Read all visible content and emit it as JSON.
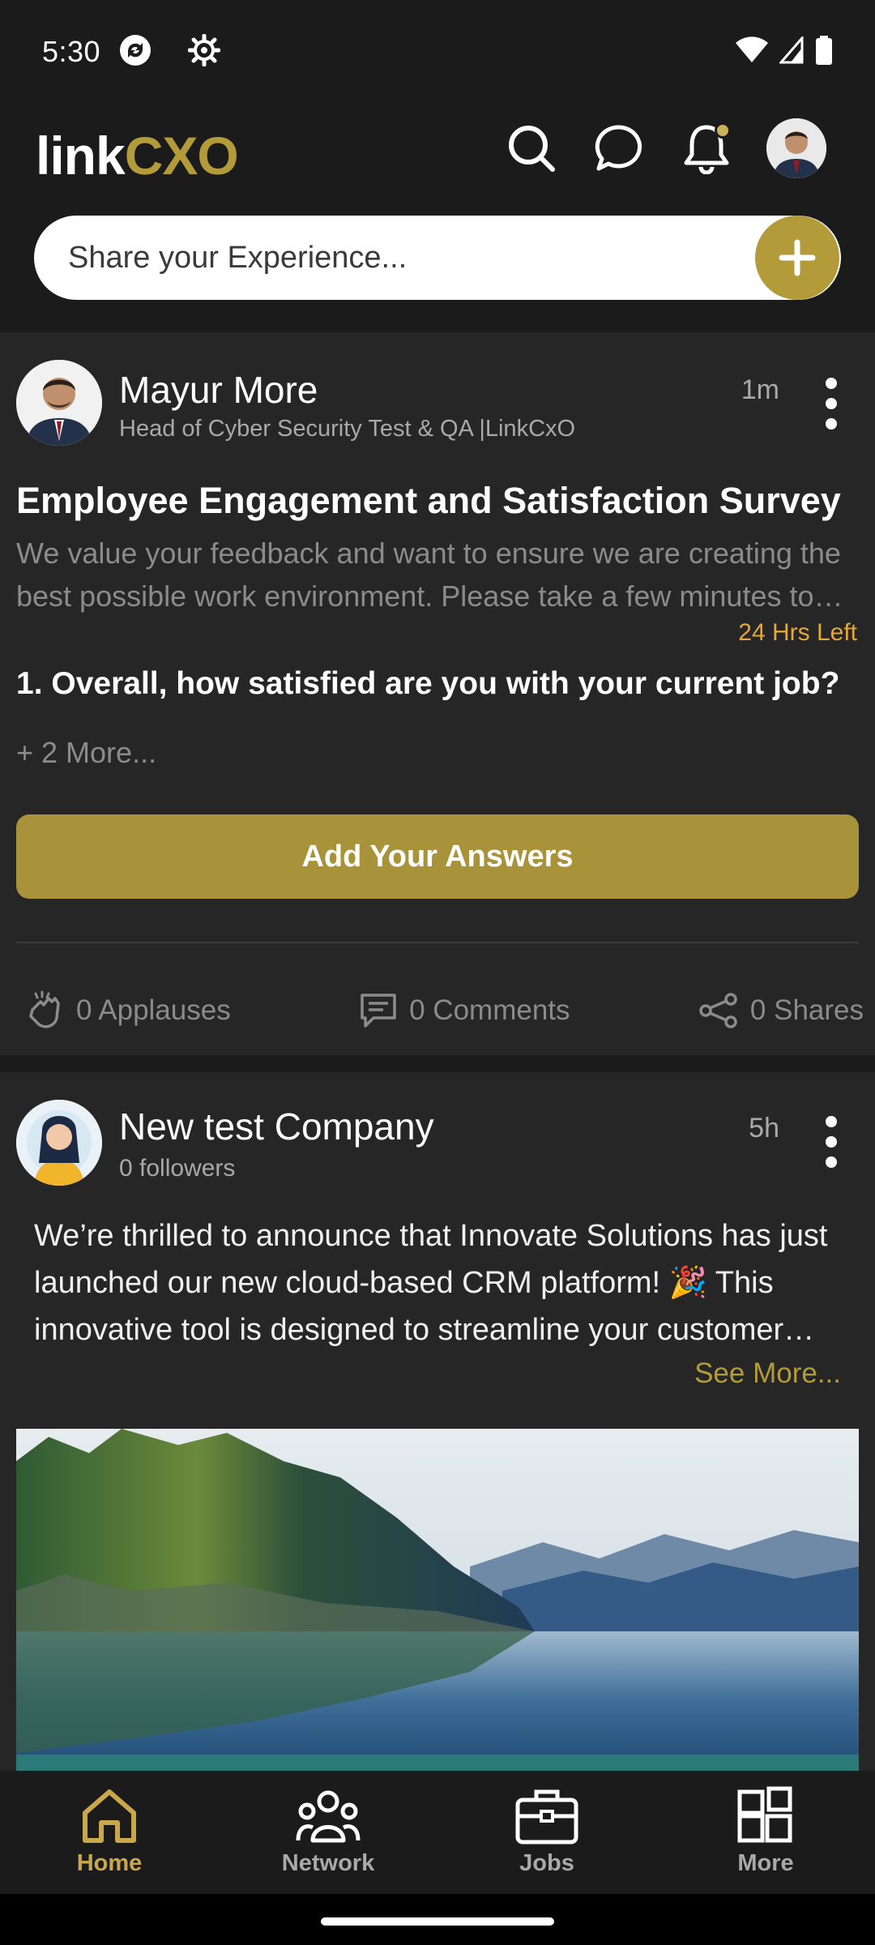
{
  "status_bar": {
    "time": "5:30"
  },
  "header": {
    "logo_prefix": "link",
    "logo_brand": "CXO",
    "share_placeholder": "Share your Experience..."
  },
  "posts": [
    {
      "author": "Mayur More",
      "subtitle": "Head of Cyber Security Test & QA |LinkCxO",
      "time": "1m",
      "survey": {
        "title": "Employee Engagement and Satisfaction Survey",
        "description": "We value your feedback and want to ensure we are creating the best possible work environment. Please take a few minutes to complete this survey.",
        "deadline": "24 Hrs Left",
        "question": "1. Overall, how satisfied are you with your current job?",
        "more": "+ 2 More...",
        "answer_label": "Add Your Answers"
      },
      "stats": {
        "applauses": "0 Applauses",
        "comments": "0 Comments",
        "shares": "0 Shares"
      }
    },
    {
      "author": "New test Company",
      "subtitle": "0 followers",
      "time": "5h",
      "body": "We’re thrilled to announce that Innovate Solutions has just launched our new cloud-based CRM platform! 🎉 This innovative tool is designed to streamline your customer relationships.",
      "see_more": "See More..."
    }
  ],
  "bottom_nav": [
    {
      "label": "Home",
      "icon": "home-icon",
      "active": true
    },
    {
      "label": "Network",
      "icon": "network-icon",
      "active": false
    },
    {
      "label": "Jobs",
      "icon": "briefcase-icon",
      "active": false
    },
    {
      "label": "More",
      "icon": "grid-icon",
      "active": false
    }
  ],
  "colors": {
    "accent": "#b39b3a",
    "background": "#262626",
    "bar": "#1b1b1b",
    "deadline": "#e3a83a",
    "nav_active": "#c9a84b"
  }
}
